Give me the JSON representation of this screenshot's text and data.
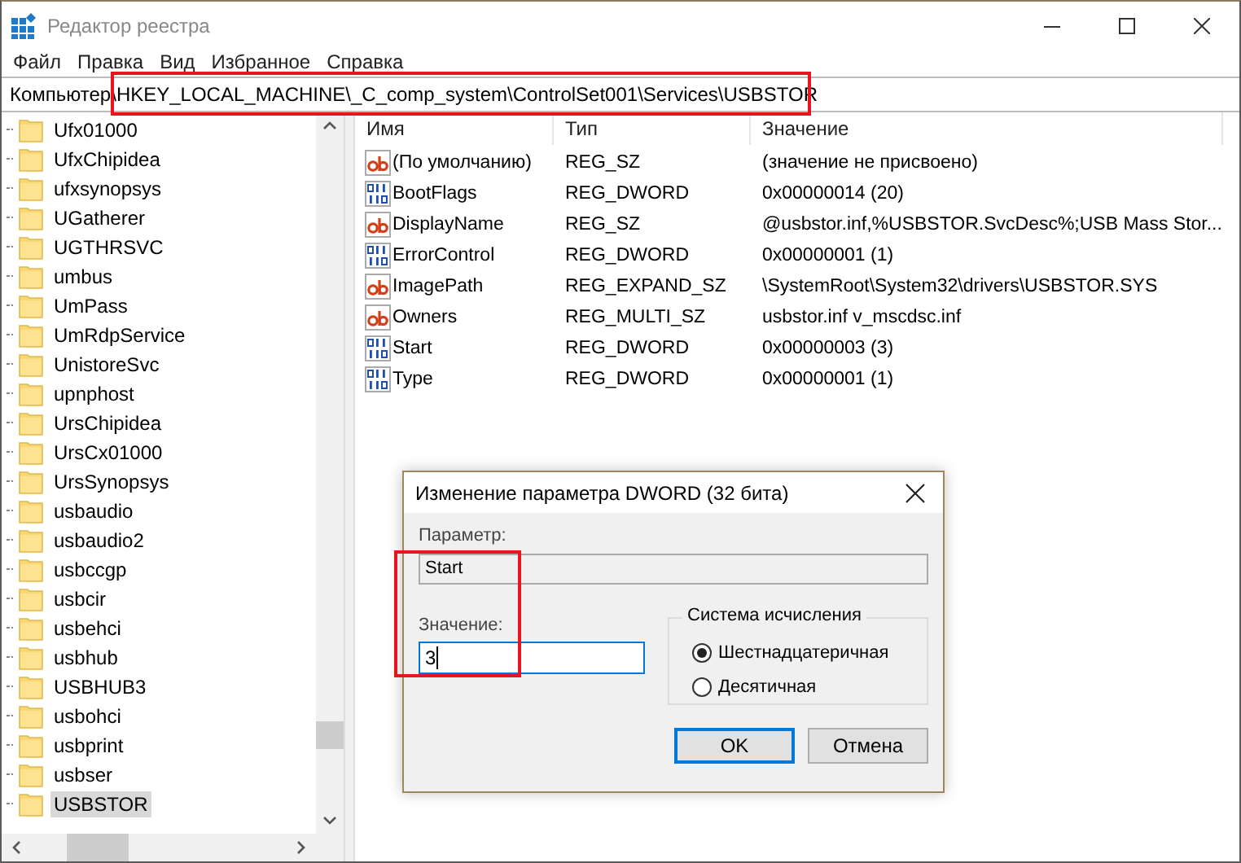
{
  "window": {
    "title": "Редактор реестра"
  },
  "menu": [
    "Файл",
    "Правка",
    "Вид",
    "Избранное",
    "Справка"
  ],
  "address": {
    "path": "Компьютер\\HKEY_LOCAL_MACHINE\\_C_comp_system\\ControlSet001\\Services\\USBSTOR",
    "highlighted": true
  },
  "tree": [
    {
      "label": "Ufx01000",
      "selected": false
    },
    {
      "label": "UfxChipidea",
      "selected": false
    },
    {
      "label": "ufxsynopsys",
      "selected": false
    },
    {
      "label": "UGatherer",
      "selected": false
    },
    {
      "label": "UGTHRSVC",
      "selected": false
    },
    {
      "label": "umbus",
      "selected": false
    },
    {
      "label": "UmPass",
      "selected": false
    },
    {
      "label": "UmRdpService",
      "selected": false
    },
    {
      "label": "UnistoreSvc",
      "selected": false
    },
    {
      "label": "upnphost",
      "selected": false
    },
    {
      "label": "UrsChipidea",
      "selected": false
    },
    {
      "label": "UrsCx01000",
      "selected": false
    },
    {
      "label": "UrsSynopsys",
      "selected": false
    },
    {
      "label": "usbaudio",
      "selected": false
    },
    {
      "label": "usbaudio2",
      "selected": false
    },
    {
      "label": "usbccgp",
      "selected": false
    },
    {
      "label": "usbcir",
      "selected": false
    },
    {
      "label": "usbehci",
      "selected": false
    },
    {
      "label": "usbhub",
      "selected": false
    },
    {
      "label": "USBHUB3",
      "selected": false
    },
    {
      "label": "usbohci",
      "selected": false
    },
    {
      "label": "usbprint",
      "selected": false
    },
    {
      "label": "usbser",
      "selected": false
    },
    {
      "label": "USBSTOR",
      "selected": true
    }
  ],
  "table": {
    "columns": [
      "Имя",
      "Тип",
      "Значение"
    ],
    "rows": [
      {
        "kind": "string",
        "name": "(По умолчанию)",
        "type": "REG_SZ",
        "value": "(значение не присвоено)"
      },
      {
        "kind": "binary",
        "name": "BootFlags",
        "type": "REG_DWORD",
        "value": "0x00000014 (20)"
      },
      {
        "kind": "string",
        "name": "DisplayName",
        "type": "REG_SZ",
        "value": "@usbstor.inf,%USBSTOR.SvcDesc%;USB Mass Stor..."
      },
      {
        "kind": "binary",
        "name": "ErrorControl",
        "type": "REG_DWORD",
        "value": "0x00000001 (1)"
      },
      {
        "kind": "string",
        "name": "ImagePath",
        "type": "REG_EXPAND_SZ",
        "value": "\\SystemRoot\\System32\\drivers\\USBSTOR.SYS"
      },
      {
        "kind": "string",
        "name": "Owners",
        "type": "REG_MULTI_SZ",
        "value": "usbstor.inf v_mscdsc.inf"
      },
      {
        "kind": "binary",
        "name": "Start",
        "type": "REG_DWORD",
        "value": "0x00000003 (3)"
      },
      {
        "kind": "binary",
        "name": "Type",
        "type": "REG_DWORD",
        "value": "0x00000001 (1)"
      }
    ]
  },
  "dialog": {
    "title": "Изменение параметра DWORD (32 бита)",
    "name_label": "Параметр:",
    "name_value": "Start",
    "value_label": "Значение:",
    "value": "3",
    "value_highlighted": true,
    "base_group": "Система исчисления",
    "bases": [
      {
        "label": "Шестнадцатеричная",
        "selected": true
      },
      {
        "label": "Десятичная",
        "selected": false
      }
    ],
    "buttons": [
      {
        "label": "OK",
        "kind": "default"
      },
      {
        "label": "Отмена",
        "kind": "normal"
      }
    ]
  }
}
